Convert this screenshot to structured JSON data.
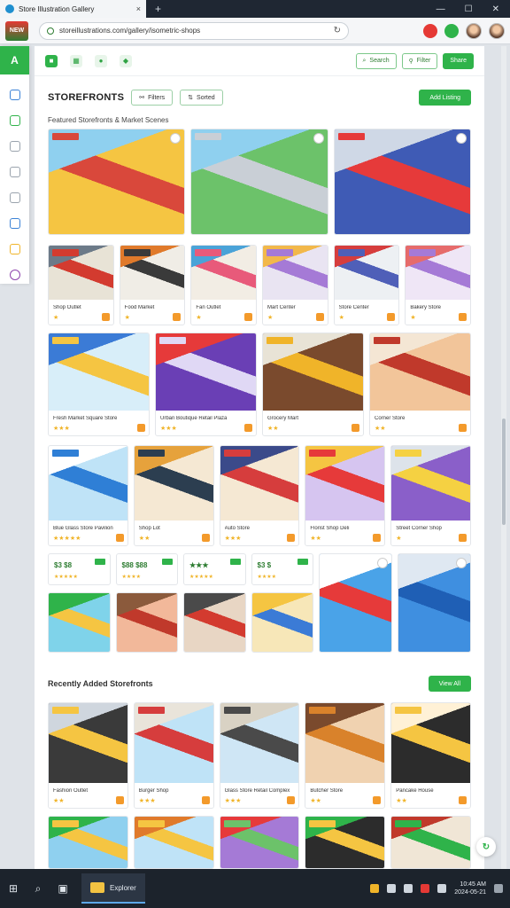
{
  "browser": {
    "tab_title": "Store Illustration Gallery",
    "tab_close": "×",
    "new_tab": "+",
    "window_controls": [
      "—",
      "☐",
      "✕"
    ],
    "address": "storeillustrations.com/gallery/isometric-shops",
    "reload": "↻"
  },
  "site": {
    "logo_text": "NEW"
  },
  "rail": {
    "brand_glyph": "A",
    "items": [
      "home",
      "shop",
      "orders",
      "lists",
      "history",
      "help",
      "favorites",
      "profile"
    ]
  },
  "topnav": {
    "items": [
      "store-icon",
      "grid-icon",
      "user-icon",
      "bell-icon"
    ],
    "search_label": "Search",
    "filter_label": "Filter",
    "share_label": "Share"
  },
  "header": {
    "title": "STOREFRONTS",
    "filter_button": "Filters",
    "sort_button": "Sorted",
    "action_button": "Add Listing"
  },
  "sections": {
    "featured_label": "Featured Storefronts & Market Scenes",
    "second_label": "Recently Added Storefronts",
    "second_button": "View All"
  },
  "cards_row1": [
    {
      "caption": "",
      "colors": [
        "#f5c542",
        "#d9483b",
        "#8fd0ef"
      ]
    },
    {
      "caption": "",
      "colors": [
        "#6cc26a",
        "#c9cfd6",
        "#8fd0ef"
      ]
    },
    {
      "caption": "",
      "colors": [
        "#3f5bb5",
        "#e63a3a",
        "#cfd8e6"
      ]
    }
  ],
  "cards_row2": [
    {
      "caption": "Shop Outlet",
      "colors": [
        "#e8e3d6",
        "#d33b2f",
        "#6c7a88"
      ]
    },
    {
      "caption": "Food Market",
      "colors": [
        "#f0ede6",
        "#3a3a3a",
        "#e07a2b"
      ]
    },
    {
      "caption": "Fan Outlet",
      "colors": [
        "#f2ede4",
        "#e85a7a",
        "#4aa3d8"
      ]
    },
    {
      "caption": "Mart Center",
      "colors": [
        "#e9e4f2",
        "#a57ad6",
        "#f2b84a"
      ]
    },
    {
      "caption": "Store Center",
      "colors": [
        "#edf0f3",
        "#4f5fb8",
        "#d63d3d"
      ]
    },
    {
      "caption": "Bakery Store",
      "colors": [
        "#efe6f6",
        "#a57ad6",
        "#e66b6b"
      ]
    }
  ],
  "cards_row3": [
    {
      "caption": "Fresh Market Square Store",
      "stars": "★★★",
      "colors": [
        "#d8eef9",
        "#f5c542",
        "#3b7bd6"
      ]
    },
    {
      "caption": "Urban Boutique Retail Plaza",
      "stars": "★★★",
      "colors": [
        "#6a3fb5",
        "#e0d8f5",
        "#e63a3a"
      ]
    },
    {
      "caption": "Grocery Mart",
      "stars": "★★",
      "colors": [
        "#7a4a2d",
        "#f0b429",
        "#e8e3d6"
      ]
    },
    {
      "caption": "Corner Store",
      "stars": "★★",
      "colors": [
        "#f2c59a",
        "#c0392b",
        "#f4e6d4"
      ]
    }
  ],
  "cards_row4": [
    {
      "caption": "Blue Glass Store Pavilion",
      "stars": "★★★★★",
      "colors": [
        "#bfe3f7",
        "#2f7fd6",
        "#ffffff"
      ]
    },
    {
      "caption": "Shop Lot",
      "stars": "★★",
      "colors": [
        "#f5e8d3",
        "#2c3e50",
        "#e6a23c"
      ]
    },
    {
      "caption": "Auto Store",
      "stars": "★★★",
      "colors": [
        "#f5e8d3",
        "#d63d3d",
        "#3b4a8a"
      ]
    },
    {
      "caption": "Florist Shop Deli",
      "stars": "★★",
      "colors": [
        "#d6c5f0",
        "#e63a3a",
        "#f5c542"
      ]
    },
    {
      "caption": "Street Corner Shop",
      "stars": "★",
      "colors": [
        "#8a5fc9",
        "#f5d142",
        "#dde3ea"
      ]
    }
  ],
  "stats": [
    {
      "value": "$3 $8",
      "stars": "★★★★★"
    },
    {
      "value": "$88 $88",
      "stars": "★★★★"
    },
    {
      "value": "★★★",
      "stars": "★★★★★"
    },
    {
      "value": "$3 $",
      "stars": "★★★★"
    }
  ],
  "cards_row5": [
    {
      "caption": "",
      "colors": [
        "#7fd3ea",
        "#f5c542",
        "#2fb34a"
      ]
    },
    {
      "caption": "",
      "colors": [
        "#f2b89a",
        "#c0392b",
        "#8b5a3c"
      ]
    },
    {
      "caption": "",
      "colors": [
        "#e8d6c4",
        "#d33b2f",
        "#4a4a4a"
      ]
    },
    {
      "caption": "",
      "colors": [
        "#f7e7b8",
        "#3b7bd6",
        "#f5c542"
      ]
    }
  ],
  "bigcards": [
    {
      "colors": [
        "#4aa3e8",
        "#e63a3a",
        "#ffffff"
      ]
    },
    {
      "colors": [
        "#3f8fe0",
        "#1f5fb5",
        "#dfe8f2"
      ]
    }
  ],
  "cards_row6": [
    {
      "caption": "Fashion Outlet",
      "stars": "★★",
      "colors": [
        "#3a3a3a",
        "#f5c542",
        "#cfd6de"
      ]
    },
    {
      "caption": "Burger Shop",
      "stars": "★★★",
      "colors": [
        "#bfe3f7",
        "#d63d3d",
        "#e9e4da"
      ]
    },
    {
      "caption": "Glass Store Retail Complex",
      "stars": "★★★",
      "colors": [
        "#cfe6f5",
        "#4a4a4a",
        "#d9d2c4"
      ]
    },
    {
      "caption": "Butcher Store",
      "stars": "★★",
      "colors": [
        "#f0d2b0",
        "#d9822b",
        "#7a4a2d"
      ]
    },
    {
      "caption": "Pancake House",
      "stars": "★★",
      "colors": [
        "#2c2c2c",
        "#f5c542",
        "#fff1d6"
      ]
    }
  ],
  "cards_row7": [
    {
      "colors": [
        "#8fd0ef",
        "#f5c542",
        "#2fb34a"
      ]
    },
    {
      "colors": [
        "#bfe3f7",
        "#f5c542",
        "#e07a2b"
      ]
    },
    {
      "colors": [
        "#a57ad6",
        "#6cc26a",
        "#e63a3a"
      ]
    },
    {
      "colors": [
        "#2c2c2c",
        "#f5c542",
        "#2fb34a"
      ]
    },
    {
      "colors": [
        "#f0e6d6",
        "#2fb34a",
        "#c0392b"
      ]
    }
  ],
  "taskbar": {
    "app_label": "Explorer",
    "time": "10:45 AM",
    "date": "2024-05-21"
  },
  "fab_glyph": "↻"
}
